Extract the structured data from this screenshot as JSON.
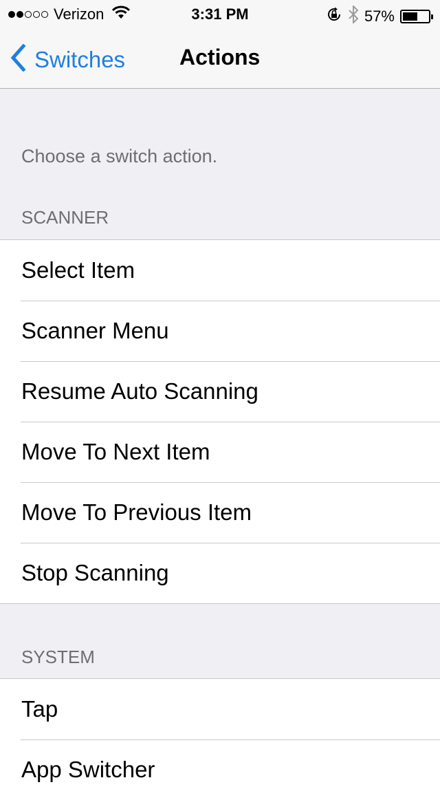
{
  "status_bar": {
    "signal_filled": 2,
    "signal_total": 5,
    "carrier": "Verizon",
    "time": "3:31 PM",
    "battery_percent_label": "57%",
    "battery_level": 0.57,
    "icons": [
      "wifi-icon",
      "rotation-lock-icon",
      "bluetooth-icon",
      "battery-icon"
    ]
  },
  "nav": {
    "back_label": "Switches",
    "title": "Actions"
  },
  "description": "Choose a switch action.",
  "sections": [
    {
      "header": "SCANNER",
      "items": [
        "Select Item",
        "Scanner Menu",
        "Resume Auto Scanning",
        "Move To Next Item",
        "Move To Previous Item",
        "Stop Scanning"
      ]
    },
    {
      "header": "SYSTEM",
      "items": [
        "Tap",
        "App Switcher"
      ]
    }
  ],
  "colors": {
    "accent": "#1f7fe0",
    "background": "#efeff4",
    "header_text": "#6d6d72"
  }
}
